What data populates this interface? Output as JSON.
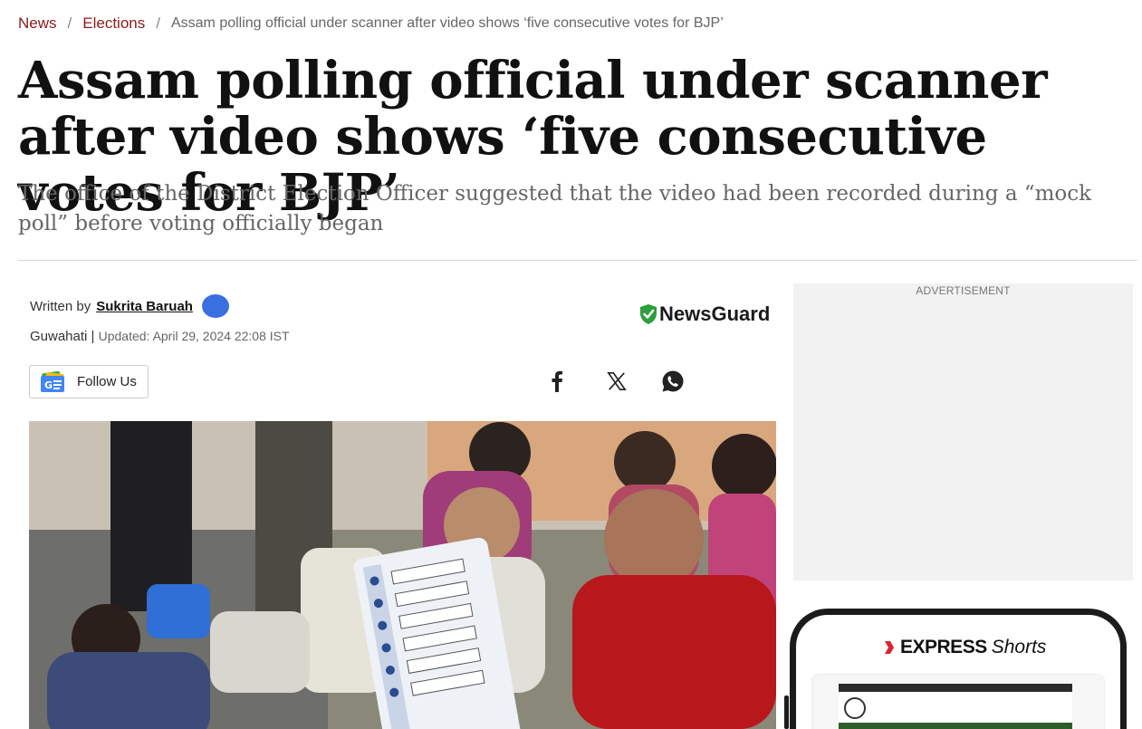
{
  "breadcrumb": {
    "items": [
      "News",
      "Elections"
    ],
    "current": "Assam polling official under scanner after video shows ‘five consecutive votes for BJP’",
    "separator": "/"
  },
  "article": {
    "headline": "Assam polling official under scanner after video shows ‘five consecutive votes for BJP’",
    "subheadline": "The office of the District Election Officer suggested that the video had been recorded during a “mock poll” before voting officially began",
    "written_by_label": "Written by",
    "author": "Sukrita Baruah",
    "location": "Guwahati",
    "meta_separator": "|",
    "updated": "Updated: April 29, 2024 22:08 IST"
  },
  "newsguard": {
    "label": "NewsGuard",
    "color": "#2e9e3e"
  },
  "follow": {
    "label": "Follow Us"
  },
  "share": {
    "icons": [
      "facebook-icon",
      "x-icon",
      "whatsapp-icon"
    ]
  },
  "sidebar": {
    "ad_label": "ADVERTISEMENT",
    "express": {
      "brand": "EXPRESS",
      "suffix": "Shorts",
      "brand_color": "#d7262e"
    }
  },
  "colors": {
    "breadcrumb_link": "#8b1a1a",
    "avatar": "#3a6fe0"
  }
}
